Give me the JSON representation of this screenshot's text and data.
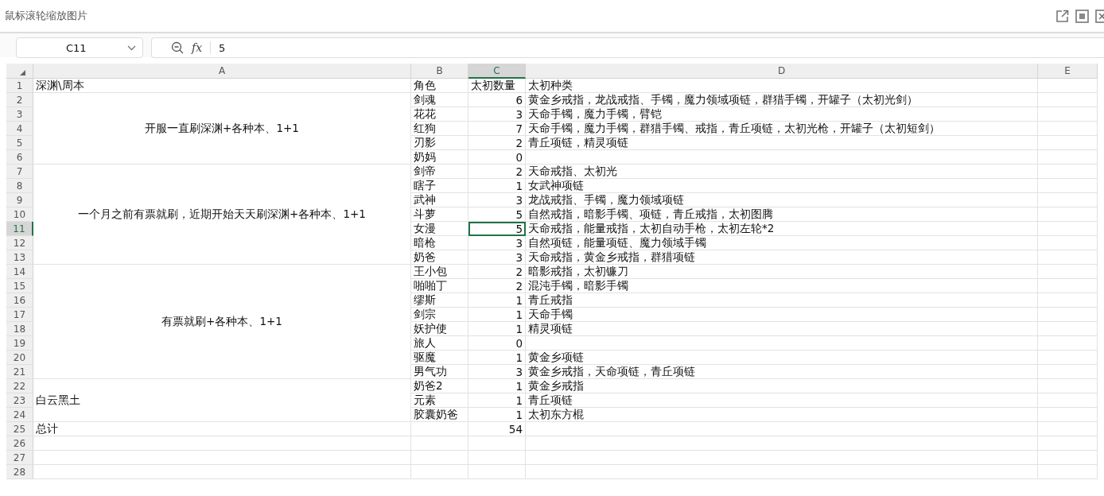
{
  "window": {
    "title": "鼠标滚轮缩放图片"
  },
  "toolbar": {
    "name_box": "C11",
    "function_label": "fx",
    "formula_value": "5"
  },
  "columns": [
    {
      "label": "A",
      "selected": false
    },
    {
      "label": "B",
      "selected": false
    },
    {
      "label": "C",
      "selected": true
    },
    {
      "label": "D",
      "selected": false
    },
    {
      "label": "E",
      "selected": false
    }
  ],
  "sections": [
    {
      "label": "深渊\\周本",
      "kind": "left",
      "rows": [
        {
          "num": "1",
          "selected": false,
          "kind": "header",
          "b": "角色",
          "c": "太初数量",
          "d": "太初种类"
        }
      ]
    },
    {
      "label": "开服一直刷深渊+各种本、1+1",
      "kind": "center",
      "rows": [
        {
          "num": "2",
          "selected": false,
          "kind": "data",
          "b": "剑魂",
          "c": "6",
          "d": "黄金乡戒指，龙战戒指、手镯，魔力领域项链，群猎手镯，开罐子（太初光剑）"
        },
        {
          "num": "3",
          "selected": false,
          "kind": "data",
          "b": "花花",
          "c": "3",
          "d": "天命手镯，魔力手镯，臂铠"
        },
        {
          "num": "4",
          "selected": false,
          "kind": "data",
          "b": "红狗",
          "c": "7",
          "d": "天命手镯，魔力手镯，群猎手镯、戒指，青丘项链，太初光枪，开罐子（太初短剑）"
        },
        {
          "num": "5",
          "selected": false,
          "kind": "data",
          "b": "刃影",
          "c": "2",
          "d": "青丘项链，精灵项链"
        },
        {
          "num": "6",
          "selected": false,
          "kind": "data",
          "b": "奶妈",
          "c": "0"
        }
      ]
    },
    {
      "label": "一个月之前有票就刷，近期开始天天刷深渊+各种本、1+1",
      "kind": "center",
      "rows": [
        {
          "num": "7",
          "selected": false,
          "kind": "data",
          "b": "剑帝",
          "c": "2",
          "d": "天命戒指、太初光"
        },
        {
          "num": "8",
          "selected": false,
          "kind": "data",
          "b": "瞎子",
          "c": "1",
          "d": "女武神项链"
        },
        {
          "num": "9",
          "selected": false,
          "kind": "data",
          "b": "武神",
          "c": "3",
          "d": "龙战戒指、手镯，魔力领域项链"
        },
        {
          "num": "10",
          "selected": false,
          "kind": "data",
          "b": "斗萝",
          "c": "5",
          "d": "自然戒指，暗影手镯、项链，青丘戒指，太初图腾"
        },
        {
          "num": "11",
          "selected": true,
          "kind": "data",
          "b": "女漫",
          "c": "5",
          "d": "天命戒指，能量戒指，太初自动手枪，太初左轮*2"
        },
        {
          "num": "12",
          "selected": false,
          "kind": "data",
          "b": "暗枪",
          "c": "3",
          "d": "自然项链，能量项链、魔力领域手镯"
        },
        {
          "num": "13",
          "selected": false,
          "kind": "data",
          "b": "奶爸",
          "c": "3",
          "d": "天命戒指，黄金乡戒指，群猎项链"
        }
      ]
    },
    {
      "label": "有票就刷+各种本、1+1",
      "kind": "center",
      "rows": [
        {
          "num": "14",
          "selected": false,
          "kind": "data",
          "b": "王小包",
          "c": "2",
          "d": "暗影戒指，太初镰刀"
        },
        {
          "num": "15",
          "selected": false,
          "kind": "data",
          "b": "啪啪丁",
          "c": "2",
          "d": "混沌手镯，暗影手镯"
        },
        {
          "num": "16",
          "selected": false,
          "kind": "data",
          "b": "缪斯",
          "c": "1",
          "d": "青丘戒指"
        },
        {
          "num": "17",
          "selected": false,
          "kind": "data",
          "b": "剑宗",
          "c": "1",
          "d": "天命手镯"
        },
        {
          "num": "18",
          "selected": false,
          "kind": "data",
          "b": "妖护使",
          "c": "1",
          "d": "精灵项链"
        },
        {
          "num": "19",
          "selected": false,
          "kind": "data",
          "b": "旅人",
          "c": "0"
        },
        {
          "num": "20",
          "selected": false,
          "kind": "data",
          "b": "驱魔",
          "c": "1",
          "d": "黄金乡项链"
        },
        {
          "num": "21",
          "selected": false,
          "kind": "data",
          "b": "男气功",
          "c": "3",
          "d": "黄金乡戒指，天命项链，青丘项链"
        }
      ]
    },
    {
      "label": "白云黑土",
      "kind": "left",
      "rows": [
        {
          "num": "22",
          "selected": false,
          "kind": "data",
          "b": "奶爸2",
          "c": "1",
          "d": "黄金乡戒指"
        },
        {
          "num": "23",
          "selected": false,
          "kind": "data",
          "b": "元素",
          "c": "1",
          "d": "青丘项链"
        },
        {
          "num": "24",
          "selected": false,
          "kind": "data",
          "b": "胶囊奶爸",
          "c": "1",
          "d": "太初东方棍"
        }
      ]
    },
    {
      "label": "总计",
      "kind": "left",
      "rows": [
        {
          "num": "25",
          "selected": false,
          "kind": "data",
          "c": "54"
        }
      ]
    },
    {
      "kind": "left",
      "rows": [
        {
          "num": "26",
          "selected": false,
          "kind": "data"
        }
      ]
    },
    {
      "kind": "left",
      "rows": [
        {
          "num": "27",
          "selected": false,
          "kind": "data"
        }
      ]
    },
    {
      "kind": "left",
      "rows": [
        {
          "num": "28",
          "selected": false,
          "kind": "data"
        }
      ]
    }
  ]
}
